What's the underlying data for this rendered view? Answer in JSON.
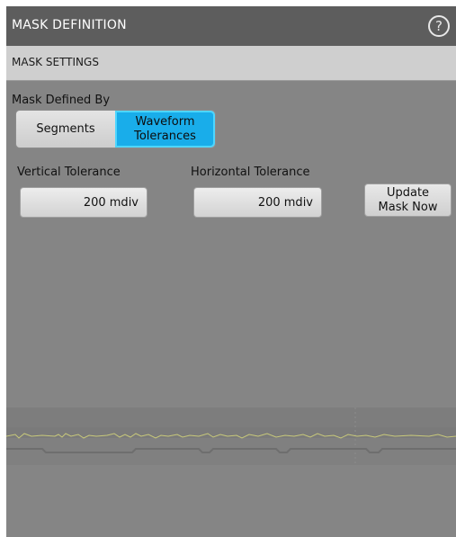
{
  "window": {
    "title": "MASK DEFINITION",
    "help_icon": "help-circle-icon"
  },
  "section": {
    "title": "MASK SETTINGS"
  },
  "mask_defined_by": {
    "label": "Mask Defined By",
    "options": [
      {
        "label": "Segments",
        "selected": false
      },
      {
        "label": "Waveform Tolerances",
        "line1": "Waveform",
        "line2": "Tolerances",
        "selected": true
      }
    ],
    "accent_color": "#19adea"
  },
  "vertical_tolerance": {
    "label": "Vertical Tolerance",
    "value": "200 mdiv"
  },
  "horizontal_tolerance": {
    "label": "Horizontal Tolerance",
    "value": "200 mdiv"
  },
  "update_button": {
    "line1": "Update",
    "line2": "Mask Now"
  },
  "colors": {
    "panel_background": "#858585",
    "title_bar": "#5d5d5d",
    "section_header": "#cfcfcf",
    "waveform_trace": "#c8c97a"
  }
}
